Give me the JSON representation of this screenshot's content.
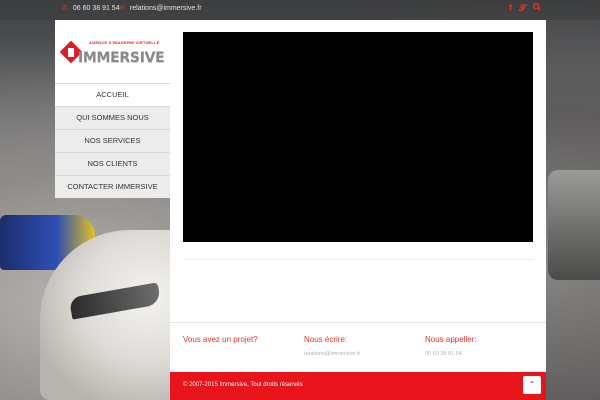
{
  "topbar": {
    "phone": "06 60 38 91 54",
    "email": "relations@immersive.fr",
    "phone_icon": "phone-icon",
    "email_icon": "envelope-icon",
    "social": [
      "facebook-icon",
      "twitter-icon",
      "search-icon"
    ]
  },
  "logo": {
    "tagline": "AGENCE D'IMAGERIE VIRTUELLE",
    "word": "IMMERSIVE"
  },
  "nav": [
    {
      "label": "ACCUEIL",
      "active": true
    },
    {
      "label": "QUI SOMMES NOUS",
      "active": false
    },
    {
      "label": "NOS SERVICES",
      "active": false
    },
    {
      "label": "NOS CLIENTS",
      "active": false
    },
    {
      "label": "CONTACTER IMMERSIVE",
      "active": false
    }
  ],
  "footer": {
    "project_title": "Vous avez un projet?",
    "write_title": "Nous écrire:",
    "write_value": "relations@immersive.fr",
    "call_title": "Nous appeller:",
    "call_value": "06 60 38 91 54",
    "copyright": "© 2007-2015 Immersive, Tout droits réservés"
  },
  "colors": {
    "accent": "#e63329",
    "bottom_bar": "#e8141b"
  }
}
